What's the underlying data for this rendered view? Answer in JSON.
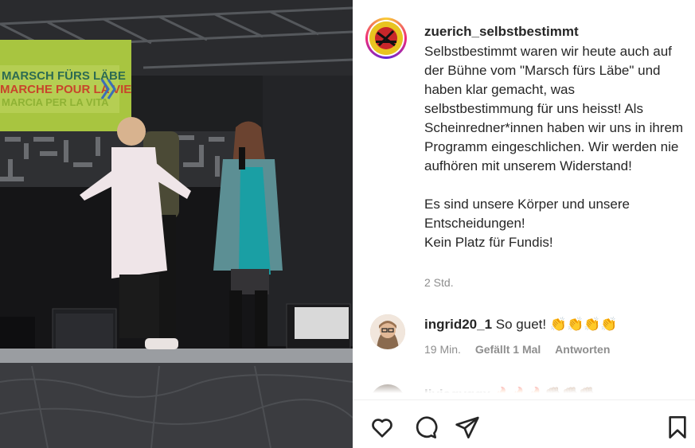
{
  "photo": {
    "banner_line1": "MARSCH FÜRS LÄBE",
    "banner_line2": "MARCHE POUR LA VIE",
    "banner_line3": "MARCIA PER LA VITA"
  },
  "post": {
    "username": "zuerich_selbstbestimmt",
    "caption": "Selbstbestimmt waren wir heute auch auf der Bühne vom \"Marsch fürs Läbe\" und haben klar gemacht, was selbstbestimmung für uns heisst! Als Scheinredner*innen haben wir uns in ihrem Programm eingeschlichen. Wir werden nie aufhören mit unserem Widerstand!\n\nEs sind unsere Körper und unsere Entscheidungen!\nKein Platz für Fundis!",
    "time": "2 Std."
  },
  "comments": [
    {
      "username": "ingrid20_1",
      "text": "So guet! 👏👏👏👏",
      "time": "19 Min.",
      "likes": "Gefällt 1 Mal",
      "reply": "Antworten"
    },
    {
      "username": "liviagyggx",
      "text": "🔥🔥🔥✊🏽✊🏽✊🏽"
    }
  ],
  "actions": {
    "like_icon": "heart-icon",
    "comment_icon": "comment-icon",
    "share_icon": "share-icon",
    "save_icon": "bookmark-icon"
  }
}
